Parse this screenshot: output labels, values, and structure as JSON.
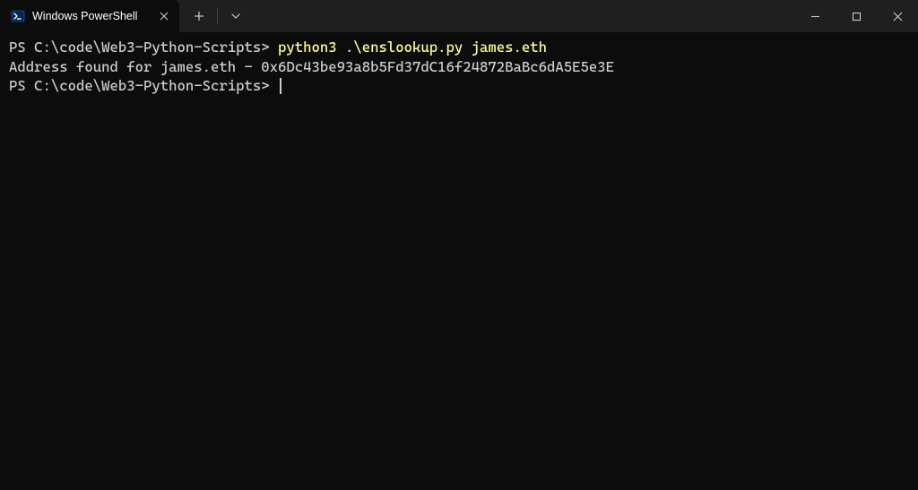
{
  "titlebar": {
    "tab_title": "Windows PowerShell"
  },
  "terminal": {
    "line1_prompt": "PS C:\\code\\Web3-Python-Scripts> ",
    "line1_command": "python3 .\\enslookup.py james.eth",
    "line2_output": "Address found for james.eth - 0x6Dc43be93a8b5Fd37dC16f24872BaBc6dA5E5e3E",
    "line3_prompt": "PS C:\\code\\Web3-Python-Scripts> "
  }
}
